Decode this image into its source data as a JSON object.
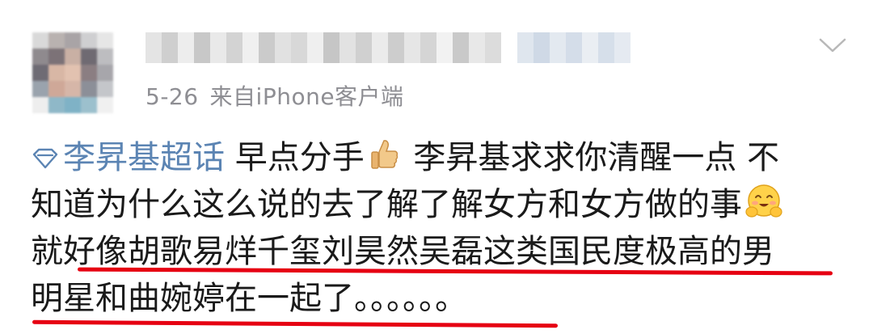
{
  "post": {
    "meta": {
      "date": "5-26",
      "source": "来自iPhone客户端"
    },
    "body": {
      "topic": "李昇基超话",
      "line1_text": " 早点分手",
      "line1_after_emoji": " 李昇基求求你清醒一点 不",
      "line2_text": "知道为什么这么说的去了解了解女方和女方做的事",
      "line3_text": "就好像胡歌易烊千玺刘昊然吴磊这类国民度极高的男",
      "line4_text": "明星和曲婉婷在一起了。。。。。。"
    },
    "icons": {
      "topic": "diamond-topic-icon",
      "thumbs_up": "thumbs-up-emoji-icon",
      "smile": "smiling-face-hands-emoji-icon",
      "chevron": "chevron-down-icon"
    },
    "colors": {
      "topic_link": "#5b84b3",
      "meta_text": "#8e8e93",
      "underline": "#e60012"
    }
  }
}
